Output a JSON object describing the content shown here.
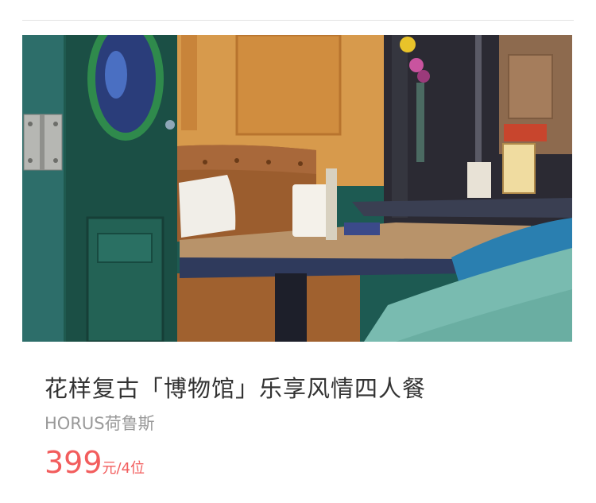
{
  "deal": {
    "title": "花样复古「博物馆」乐享风情四人餐",
    "shop_name": "HORUS荷鲁斯",
    "price": "399",
    "price_unit": "元/4位",
    "image_alt": "restaurant-interior-photo"
  },
  "colors": {
    "price": "#f25d5d",
    "title": "#333333",
    "subtitle": "#999999",
    "divider": "#e3e3e3"
  }
}
